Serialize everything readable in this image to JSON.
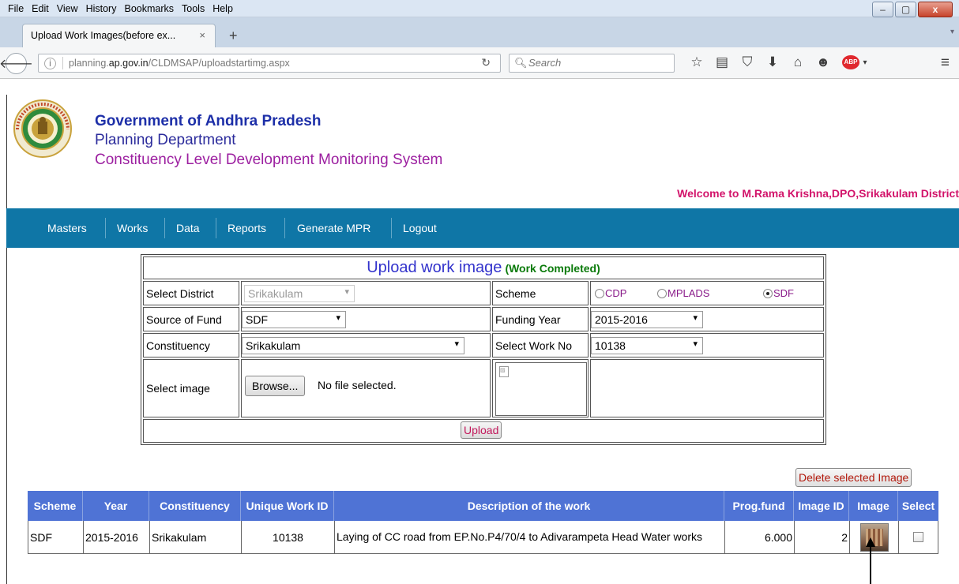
{
  "browser": {
    "menu": [
      "File",
      "Edit",
      "View",
      "History",
      "Bookmarks",
      "Tools",
      "Help"
    ],
    "window_buttons": {
      "minimize": "–",
      "maximize": "▢",
      "close": "x"
    },
    "tab_title": "Upload Work Images(before ex...",
    "tab_close": "×",
    "new_tab": "+",
    "url_prefix": "planning.",
    "url_domain": "ap.gov.in",
    "url_path": "/CLDMSAP/uploadstartimg.aspx",
    "search_placeholder": "Search"
  },
  "header": {
    "gov": "Government of Andhra Pradesh",
    "dept": "Planning Department",
    "system": "Constituency Level Development Monitoring System",
    "welcome": "Welcome to M.Rama Krishna,DPO,Srikakulam District"
  },
  "nav": [
    "Masters",
    "Works",
    "Data",
    "Reports",
    "Generate MPR",
    "Logout"
  ],
  "form": {
    "title": "Upload work image",
    "subtitle": "(Work Completed)",
    "select_district_label": "Select District",
    "select_district_value": "Srikakulam",
    "scheme_label": "Scheme",
    "scheme_options": [
      "CDP",
      "MPLADS",
      "SDF"
    ],
    "scheme_selected": "SDF",
    "source_of_fund_label": "Source of Fund",
    "source_of_fund_value": "SDF",
    "funding_year_label": "Funding Year",
    "funding_year_value": "2015-2016",
    "constituency_label": "Constituency",
    "constituency_value": "Srikakulam",
    "select_work_no_label": "Select Work No",
    "select_work_no_value": "10138",
    "select_image_label": "Select image",
    "browse_label": "Browse...",
    "no_file": "No file selected.",
    "upload_label": "Upload"
  },
  "results": {
    "delete_label": "Delete selected Image",
    "headers": [
      "Scheme",
      "Year",
      "Constituency",
      "Unique Work ID",
      "Description of the work",
      "Prog.fund",
      "Image ID",
      "Image",
      "Select"
    ],
    "rows": [
      {
        "scheme": "SDF",
        "year": "2015-2016",
        "constituency": "Srikakulam",
        "unique_work_id": "10138",
        "description": "Laying of CC road from EP.No.P4/70/4 to Adivarampeta Head Water works",
        "prog_fund": "6.000",
        "image_id": "2"
      }
    ]
  },
  "colors": {
    "nav_bg": "#0f76a6",
    "table_header_bg": "#4f73d5",
    "welcome": "#d2136a",
    "gov_title": "#1d2fa8",
    "system_title": "#9c1fa0"
  }
}
